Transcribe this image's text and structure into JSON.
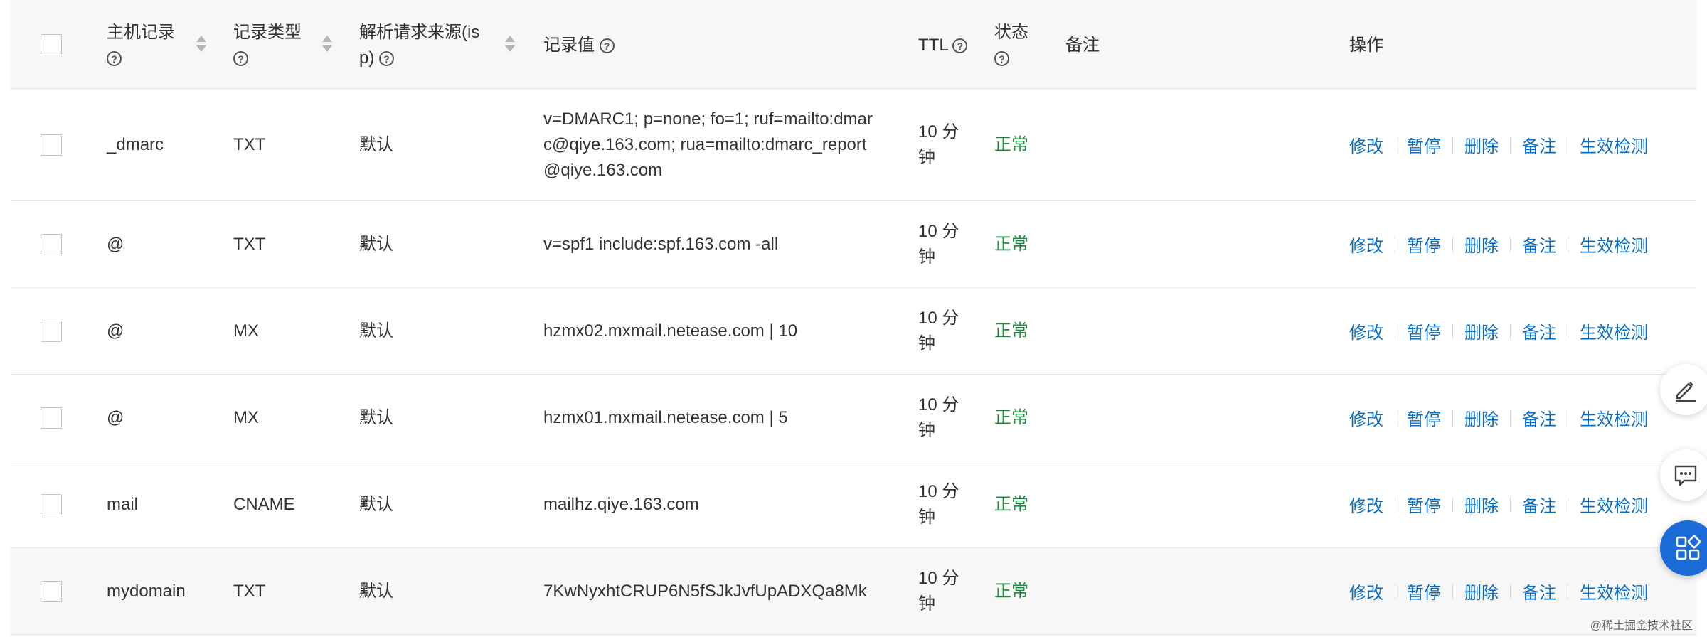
{
  "table": {
    "columns": {
      "host": "主机记录",
      "type": "记录类型",
      "isp_line1": "解析请求来源(is",
      "isp_line2": "p)",
      "value": "记录值",
      "ttl": "TTL",
      "status": "状态",
      "remark": "备注",
      "ops": "操作"
    },
    "rows": [
      {
        "host": "_dmarc",
        "type": "TXT",
        "isp": "默认",
        "value_lines": [
          "v=DMARC1; p=none; fo=1; ruf=mailto:dmar",
          "c@qiye.163.com; rua=mailto:dmarc_report",
          "@qiye.163.com"
        ],
        "ttl_line1": "10 分",
        "ttl_line2": "钟",
        "status": "正常"
      },
      {
        "host": "@",
        "type": "TXT",
        "isp": "默认",
        "value_lines": [
          "v=spf1 include:spf.163.com -all"
        ],
        "ttl_line1": "10 分",
        "ttl_line2": "钟",
        "status": "正常"
      },
      {
        "host": "@",
        "type": "MX",
        "isp": "默认",
        "value_lines": [
          "hzmx02.mxmail.netease.com | 10"
        ],
        "ttl_line1": "10 分",
        "ttl_line2": "钟",
        "status": "正常"
      },
      {
        "host": "@",
        "type": "MX",
        "isp": "默认",
        "value_lines": [
          "hzmx01.mxmail.netease.com | 5"
        ],
        "ttl_line1": "10 分",
        "ttl_line2": "钟",
        "status": "正常"
      },
      {
        "host": "mail",
        "type": "CNAME",
        "isp": "默认",
        "value_lines": [
          "mailhz.qiye.163.com"
        ],
        "ttl_line1": "10 分",
        "ttl_line2": "钟",
        "status": "正常"
      },
      {
        "host": "mydomain",
        "type": "TXT",
        "isp": "默认",
        "value_lines": [
          "7KwNyxhtCRUP6N5fSJkJvfUpADXQa8Mk"
        ],
        "ttl_line1": "10 分",
        "ttl_line2": "钟",
        "status": "正常"
      }
    ],
    "actions": [
      "修改",
      "暂停",
      "删除",
      "备注",
      "生效检测"
    ]
  },
  "floating": {
    "edit_icon": "edit-icon",
    "comment_icon": "comment-icon",
    "apps_icon": "apps-icon"
  },
  "watermark": "@稀土掘金技术社区",
  "colors": {
    "link": "#0a6fc2",
    "status_ok": "#1e8e3e",
    "primary": "#1a6ad8"
  }
}
